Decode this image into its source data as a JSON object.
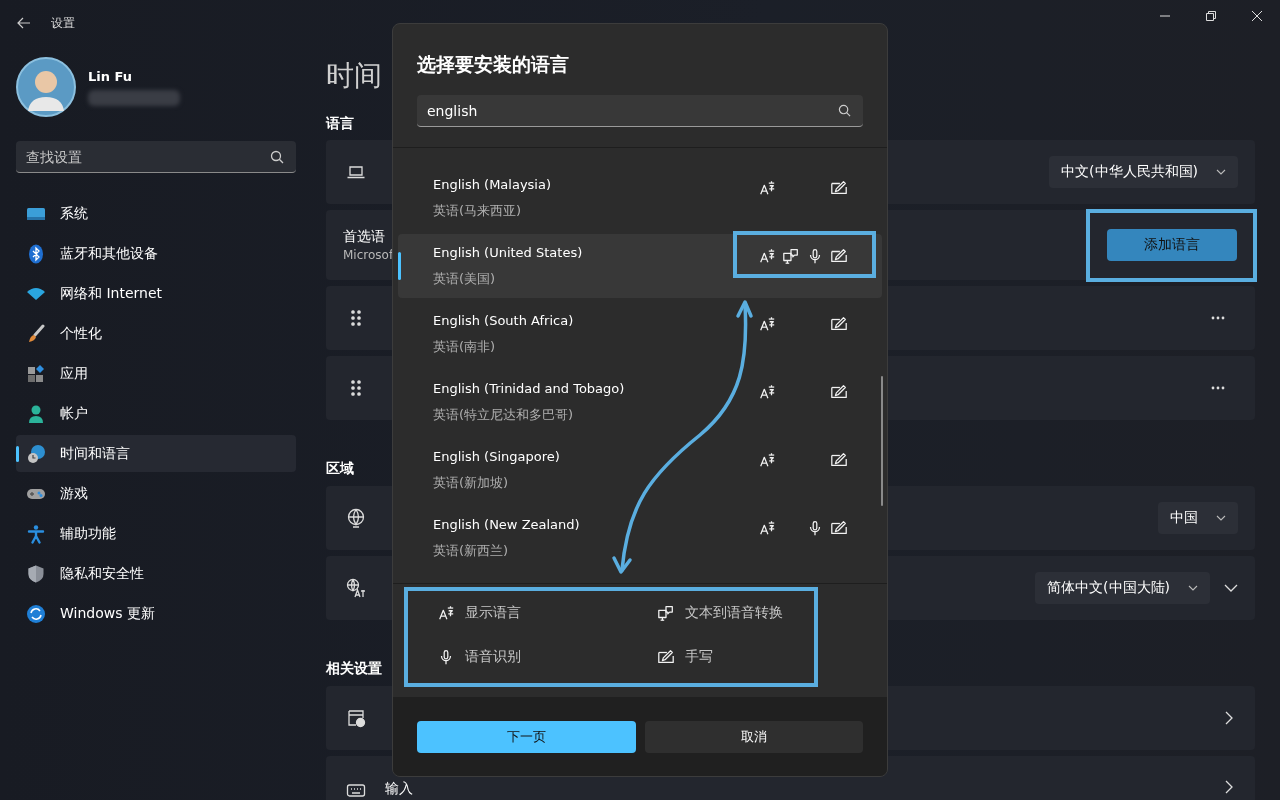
{
  "window": {
    "title": "设置"
  },
  "account": {
    "name": "Lin Fu"
  },
  "search": {
    "placeholder": "查找设置"
  },
  "nav": [
    {
      "label": "系统",
      "selected": false
    },
    {
      "label": "蓝牙和其他设备",
      "selected": false
    },
    {
      "label": "网络和 Internet",
      "selected": false
    },
    {
      "label": "个性化",
      "selected": false
    },
    {
      "label": "应用",
      "selected": false
    },
    {
      "label": "帐户",
      "selected": false
    },
    {
      "label": "时间和语言",
      "selected": true
    },
    {
      "label": "游戏",
      "selected": false
    },
    {
      "label": "辅助功能",
      "selected": false
    },
    {
      "label": "隐私和安全性",
      "selected": false
    },
    {
      "label": "Windows 更新",
      "selected": false
    }
  ],
  "page": {
    "title": "时间",
    "sections": [
      {
        "heading": "语言",
        "cards": [
          {
            "kind": "dropdown",
            "value": "中文(中华人民共和国)"
          },
          {
            "kind": "button",
            "title": "首选语",
            "subtitle": "Microsof",
            "button": "添加语言"
          },
          {
            "kind": "more"
          },
          {
            "kind": "more"
          }
        ]
      },
      {
        "heading": "区域",
        "cards": [
          {
            "kind": "dropdown",
            "value": "中国"
          },
          {
            "kind": "dropdown-expand",
            "value": "简体中文(中国大陆)"
          }
        ]
      },
      {
        "heading": "相关设置",
        "cards": [
          {
            "kind": "link"
          },
          {
            "kind": "link",
            "title": "输入"
          }
        ]
      }
    ]
  },
  "dialog": {
    "title": "选择要安装的语言",
    "search": {
      "value": "english"
    },
    "languages": [
      {
        "name": "English (Malaysia)",
        "native": "英语(马来西亚)",
        "selected": false,
        "display": true,
        "tts": false,
        "speech": false,
        "handwriting": true
      },
      {
        "name": "English (United States)",
        "native": "英语(美国)",
        "selected": true,
        "display": true,
        "tts": true,
        "speech": true,
        "handwriting": true
      },
      {
        "name": "English (South Africa)",
        "native": "英语(南非)",
        "selected": false,
        "display": true,
        "tts": false,
        "speech": false,
        "handwriting": true
      },
      {
        "name": "English (Trinidad and Tobago)",
        "native": "英语(特立尼达和多巴哥)",
        "selected": false,
        "display": true,
        "tts": false,
        "speech": false,
        "handwriting": true
      },
      {
        "name": "English (Singapore)",
        "native": "英语(新加坡)",
        "selected": false,
        "display": true,
        "tts": false,
        "speech": false,
        "handwriting": true
      },
      {
        "name": "English (New Zealand)",
        "native": "英语(新西兰)",
        "selected": false,
        "display": true,
        "tts": false,
        "speech": true,
        "handwriting": true
      }
    ],
    "legend": [
      {
        "kind": "display",
        "label": "显示语言"
      },
      {
        "kind": "tts",
        "label": "文本到语音转换"
      },
      {
        "kind": "speech",
        "label": "语音识别"
      },
      {
        "kind": "handwriting",
        "label": "手写"
      }
    ],
    "buttons": [
      {
        "label": "下一页",
        "primary": true
      },
      {
        "label": "取消",
        "primary": false
      }
    ]
  }
}
